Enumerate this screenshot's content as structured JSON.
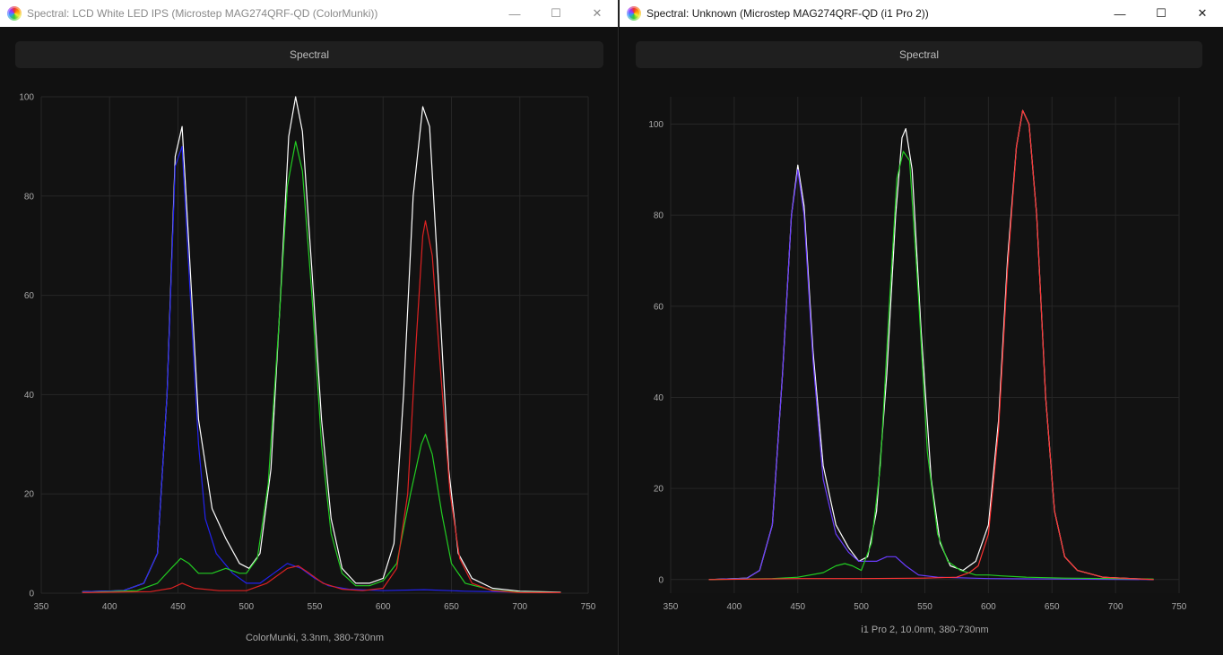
{
  "windows": [
    {
      "title": "Spectral: LCD White LED IPS (Microstep MAG274QRF-QD (ColorMunki))",
      "tab_label": "Spectral",
      "controls": {
        "minimize": "—",
        "maximize": "☐",
        "close": "✕"
      },
      "chart_data": {
        "type": "line",
        "caption": "ColorMunki, 3.3nm, 380-730nm",
        "xlim": [
          350,
          750
        ],
        "ylim": [
          0,
          100
        ],
        "xticks": [
          350,
          400,
          450,
          500,
          550,
          600,
          650,
          700,
          750
        ],
        "yticks": [
          0,
          20,
          40,
          60,
          80,
          100
        ],
        "grid": true,
        "series": [
          {
            "color": "#ffffff",
            "points": [
              [
                380,
                0.3
              ],
              [
                410,
                0.5
              ],
              [
                425,
                2
              ],
              [
                435,
                8
              ],
              [
                442,
                40
              ],
              [
                448,
                88
              ],
              [
                453,
                94
              ],
              [
                458,
                70
              ],
              [
                465,
                35
              ],
              [
                475,
                17
              ],
              [
                485,
                11
              ],
              [
                495,
                6
              ],
              [
                502,
                5
              ],
              [
                510,
                8
              ],
              [
                518,
                25
              ],
              [
                525,
                60
              ],
              [
                531,
                92
              ],
              [
                536,
                100
              ],
              [
                541,
                93
              ],
              [
                548,
                65
              ],
              [
                555,
                35
              ],
              [
                562,
                15
              ],
              [
                570,
                5
              ],
              [
                580,
                2
              ],
              [
                590,
                2
              ],
              [
                600,
                3
              ],
              [
                608,
                10
              ],
              [
                615,
                40
              ],
              [
                622,
                80
              ],
              [
                629,
                98
              ],
              [
                634,
                94
              ],
              [
                640,
                65
              ],
              [
                648,
                25
              ],
              [
                655,
                8
              ],
              [
                665,
                3
              ],
              [
                680,
                1
              ],
              [
                700,
                0.4
              ],
              [
                730,
                0.2
              ]
            ]
          },
          {
            "color": "#2222ee",
            "points": [
              [
                380,
                0.3
              ],
              [
                410,
                0.5
              ],
              [
                425,
                2
              ],
              [
                435,
                8
              ],
              [
                442,
                40
              ],
              [
                448,
                86
              ],
              [
                453,
                90
              ],
              [
                458,
                65
              ],
              [
                465,
                30
              ],
              [
                470,
                15
              ],
              [
                478,
                8
              ],
              [
                490,
                4
              ],
              [
                500,
                2
              ],
              [
                510,
                2
              ],
              [
                520,
                4
              ],
              [
                530,
                6
              ],
              [
                540,
                5
              ],
              [
                550,
                3
              ],
              [
                560,
                1.5
              ],
              [
                575,
                0.8
              ],
              [
                600,
                0.5
              ],
              [
                630,
                0.7
              ],
              [
                660,
                0.4
              ],
              [
                700,
                0.2
              ],
              [
                730,
                0.1
              ]
            ]
          },
          {
            "color": "#22cc22",
            "points": [
              [
                380,
                0.1
              ],
              [
                420,
                0.5
              ],
              [
                435,
                2
              ],
              [
                445,
                5
              ],
              [
                452,
                7
              ],
              [
                458,
                6
              ],
              [
                465,
                4
              ],
              [
                475,
                4
              ],
              [
                485,
                5
              ],
              [
                495,
                4
              ],
              [
                500,
                4
              ],
              [
                508,
                7
              ],
              [
                516,
                22
              ],
              [
                524,
                55
              ],
              [
                530,
                82
              ],
              [
                536,
                91
              ],
              [
                541,
                85
              ],
              [
                548,
                60
              ],
              [
                555,
                30
              ],
              [
                562,
                12
              ],
              [
                570,
                4
              ],
              [
                580,
                1.5
              ],
              [
                590,
                1.5
              ],
              [
                600,
                2.5
              ],
              [
                610,
                6
              ],
              [
                620,
                20
              ],
              [
                628,
                30
              ],
              [
                631,
                32
              ],
              [
                636,
                28
              ],
              [
                643,
                16
              ],
              [
                650,
                6
              ],
              [
                660,
                2
              ],
              [
                680,
                0.6
              ],
              [
                700,
                0.2
              ],
              [
                730,
                0.1
              ]
            ]
          },
          {
            "color": "#dd2222",
            "points": [
              [
                380,
                0.1
              ],
              [
                430,
                0.3
              ],
              [
                445,
                1
              ],
              [
                453,
                2
              ],
              [
                462,
                1
              ],
              [
                480,
                0.5
              ],
              [
                500,
                0.5
              ],
              [
                515,
                2
              ],
              [
                530,
                5
              ],
              [
                538,
                5.5
              ],
              [
                546,
                4
              ],
              [
                556,
                2
              ],
              [
                570,
                0.8
              ],
              [
                585,
                0.5
              ],
              [
                600,
                1
              ],
              [
                610,
                5
              ],
              [
                618,
                20
              ],
              [
                624,
                50
              ],
              [
                629,
                72
              ],
              [
                631,
                75
              ],
              [
                636,
                68
              ],
              [
                642,
                45
              ],
              [
                649,
                20
              ],
              [
                656,
                7
              ],
              [
                665,
                2
              ],
              [
                680,
                0.5
              ],
              [
                700,
                0.1
              ],
              [
                730,
                0.1
              ]
            ]
          }
        ]
      }
    },
    {
      "title": "Spectral: Unknown (Microstep MAG274QRF-QD (i1 Pro 2))",
      "tab_label": "Spectral",
      "controls": {
        "minimize": "—",
        "maximize": "☐",
        "close": "✕"
      },
      "chart_data": {
        "type": "line",
        "caption": "i1 Pro 2, 10.0nm, 380-730nm",
        "xlim": [
          350,
          750
        ],
        "ylim": [
          -3,
          106
        ],
        "xticks": [
          350,
          400,
          450,
          500,
          550,
          600,
          650,
          700,
          750
        ],
        "yticks": [
          0,
          20,
          40,
          60,
          80,
          100
        ],
        "grid": true,
        "series": [
          {
            "color": "#ffffff",
            "points": [
              [
                380,
                0
              ],
              [
                410,
                0.3
              ],
              [
                420,
                2
              ],
              [
                430,
                12
              ],
              [
                438,
                45
              ],
              [
                445,
                80
              ],
              [
                450,
                91
              ],
              [
                455,
                82
              ],
              [
                462,
                50
              ],
              [
                470,
                25
              ],
              [
                480,
                12
              ],
              [
                490,
                7
              ],
              [
                498,
                4
              ],
              [
                505,
                5
              ],
              [
                512,
                15
              ],
              [
                520,
                45
              ],
              [
                527,
                80
              ],
              [
                532,
                97
              ],
              [
                535,
                99
              ],
              [
                540,
                90
              ],
              [
                547,
                55
              ],
              [
                555,
                22
              ],
              [
                562,
                8
              ],
              [
                570,
                3
              ],
              [
                580,
                2
              ],
              [
                590,
                4
              ],
              [
                600,
                12
              ],
              [
                608,
                35
              ],
              [
                615,
                70
              ],
              [
                622,
                95
              ],
              [
                627,
                103
              ],
              [
                632,
                100
              ],
              [
                638,
                80
              ],
              [
                645,
                40
              ],
              [
                652,
                15
              ],
              [
                660,
                5
              ],
              [
                670,
                2
              ],
              [
                690,
                0.5
              ],
              [
                730,
                0
              ]
            ]
          },
          {
            "color": "#6a3cff",
            "points": [
              [
                380,
                0
              ],
              [
                410,
                0.3
              ],
              [
                420,
                2
              ],
              [
                430,
                12
              ],
              [
                438,
                45
              ],
              [
                445,
                80
              ],
              [
                450,
                90
              ],
              [
                455,
                80
              ],
              [
                462,
                48
              ],
              [
                470,
                22
              ],
              [
                480,
                10
              ],
              [
                490,
                6
              ],
              [
                498,
                4
              ],
              [
                505,
                4
              ],
              [
                512,
                4
              ],
              [
                520,
                5
              ],
              [
                527,
                5
              ],
              [
                535,
                3
              ],
              [
                545,
                1
              ],
              [
                560,
                0.5
              ],
              [
                600,
                0.2
              ],
              [
                650,
                0.1
              ],
              [
                730,
                0
              ]
            ]
          },
          {
            "color": "#22cc22",
            "points": [
              [
                380,
                0
              ],
              [
                430,
                0.2
              ],
              [
                450,
                0.5
              ],
              [
                470,
                1.5
              ],
              [
                480,
                3
              ],
              [
                487,
                3.5
              ],
              [
                493,
                3
              ],
              [
                500,
                2
              ],
              [
                508,
                8
              ],
              [
                515,
                25
              ],
              [
                522,
                60
              ],
              [
                528,
                88
              ],
              [
                533,
                94
              ],
              [
                538,
                92
              ],
              [
                545,
                62
              ],
              [
                552,
                28
              ],
              [
                560,
                10
              ],
              [
                568,
                4
              ],
              [
                578,
                2
              ],
              [
                590,
                1
              ],
              [
                600,
                1
              ],
              [
                610,
                0.8
              ],
              [
                630,
                0.5
              ],
              [
                660,
                0.3
              ],
              [
                700,
                0.2
              ],
              [
                730,
                0.1
              ]
            ]
          },
          {
            "color": "#ff3333",
            "points": [
              [
                380,
                0
              ],
              [
                450,
                0.2
              ],
              [
                500,
                0.2
              ],
              [
                550,
                0.3
              ],
              [
                575,
                0.5
              ],
              [
                585,
                1.5
              ],
              [
                592,
                3
              ],
              [
                600,
                10
              ],
              [
                608,
                33
              ],
              [
                615,
                68
              ],
              [
                622,
                95
              ],
              [
                627,
                103
              ],
              [
                632,
                100
              ],
              [
                638,
                80
              ],
              [
                645,
                40
              ],
              [
                652,
                15
              ],
              [
                660,
                5
              ],
              [
                670,
                2
              ],
              [
                690,
                0.5
              ],
              [
                730,
                0
              ]
            ]
          }
        ]
      }
    }
  ]
}
